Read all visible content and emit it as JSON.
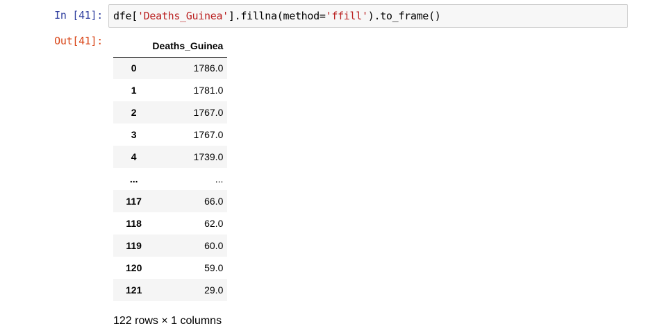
{
  "cell": {
    "in_prompt": "In [41]:",
    "out_prompt": "Out[41]:",
    "code": {
      "pre": "dfe[",
      "str1": "'Deaths_Guinea'",
      "mid": "].fillna(method=",
      "str2": "'ffill'",
      "post": ").to_frame()"
    }
  },
  "dataframe": {
    "column": "Deaths_Guinea",
    "rows": [
      {
        "index": "0",
        "value": "1786.0"
      },
      {
        "index": "1",
        "value": "1781.0"
      },
      {
        "index": "2",
        "value": "1767.0"
      },
      {
        "index": "3",
        "value": "1767.0"
      },
      {
        "index": "4",
        "value": "1739.0"
      },
      {
        "index": "...",
        "value": "..."
      },
      {
        "index": "117",
        "value": "66.0"
      },
      {
        "index": "118",
        "value": "62.0"
      },
      {
        "index": "119",
        "value": "60.0"
      },
      {
        "index": "120",
        "value": "59.0"
      },
      {
        "index": "121",
        "value": "29.0"
      }
    ],
    "shape_text": "122 rows × 1 columns"
  }
}
